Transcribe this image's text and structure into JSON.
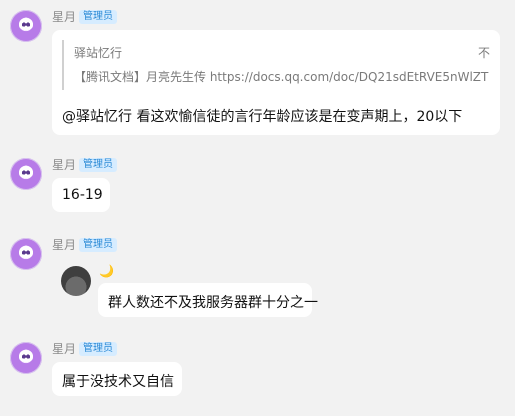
{
  "messages": [
    {
      "name": "星月",
      "badge": "管理员",
      "quote": {
        "title": "驿站忆行",
        "right_char": "不",
        "text": "【腾讯文档】月亮先生传 https://docs.qq.com/doc/DQ21sdEtRVE5nWlZT"
      },
      "text": "@驿站忆行 看这欢愉信徒的言行年龄应该是在变声期上，20以下"
    },
    {
      "name": "星月",
      "badge": "管理员",
      "text": "16-19"
    },
    {
      "name": "星月",
      "badge": "管理员",
      "text": "群人数还不及我服务器群十分之一"
    },
    {
      "name": "星月",
      "badge": "管理员",
      "text": "属于没技术又自信"
    }
  ],
  "icons": {
    "avatar": "purple-anime-avatar",
    "reply_avatar": "dark-avatar",
    "moon": "crescent-moon-icon"
  }
}
